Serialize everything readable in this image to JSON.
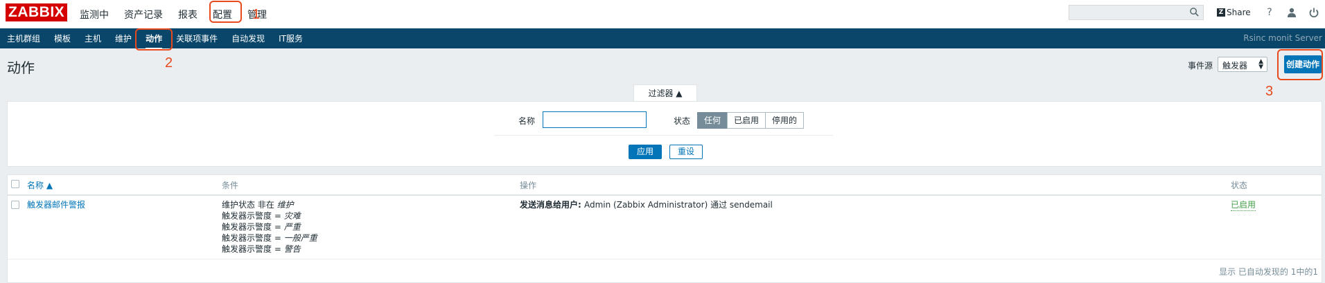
{
  "header": {
    "logo": "ZABBIX",
    "menu": [
      {
        "label": "监测中"
      },
      {
        "label": "资产记录"
      },
      {
        "label": "报表"
      },
      {
        "label": "配置"
      },
      {
        "label": "管理"
      }
    ],
    "share_label": "Share",
    "help_glyph": "?",
    "icons": [
      "search-icon",
      "share-icon",
      "help-icon",
      "user-icon",
      "power-icon"
    ]
  },
  "subnav": {
    "items": [
      {
        "label": "主机群组"
      },
      {
        "label": "模板"
      },
      {
        "label": "主机"
      },
      {
        "label": "维护"
      },
      {
        "label": "动作"
      },
      {
        "label": "关联项事件"
      },
      {
        "label": "自动发现"
      },
      {
        "label": "IT服务"
      }
    ],
    "server_name": "Rsinc monit Server"
  },
  "page": {
    "title": "动作",
    "event_source_label": "事件源",
    "event_source_value": "触发器",
    "create_button": "创建动作"
  },
  "filter": {
    "tab_label": "过滤器 ▲",
    "name_label": "名称",
    "name_value": "",
    "status_label": "状态",
    "status_options": [
      "任何",
      "已启用",
      "停用的"
    ],
    "status_selected": "任何",
    "apply_button": "应用",
    "reset_button": "重设"
  },
  "table": {
    "headers": {
      "name": "名称 ▲",
      "conditions": "条件",
      "operations": "操作",
      "status": "状态"
    },
    "rows": [
      {
        "name": "触发器邮件警报",
        "conditions": [
          {
            "prefix": "维护状态 非在 ",
            "value": "维护"
          },
          {
            "prefix": "触发器示警度 = ",
            "value": "灾难"
          },
          {
            "prefix": "触发器示警度 = ",
            "value": "严重"
          },
          {
            "prefix": "触发器示警度 = ",
            "value": "一般严重"
          },
          {
            "prefix": "触发器示警度 = ",
            "value": "警告"
          }
        ],
        "operation_prefix": "发送消息给用户: ",
        "operation_text": "Admin (Zabbix Administrator) 通过 sendemail",
        "status": "已启用"
      }
    ],
    "footer": "显示 已自动发现的 1中的1"
  },
  "annotations": [
    "1",
    "2",
    "3"
  ],
  "colors": {
    "accent": "#0275b8",
    "subnav_bg": "#0a466a",
    "logo_bg": "#d40000",
    "enabled": "#429e47",
    "annotation": "#e8491d"
  }
}
